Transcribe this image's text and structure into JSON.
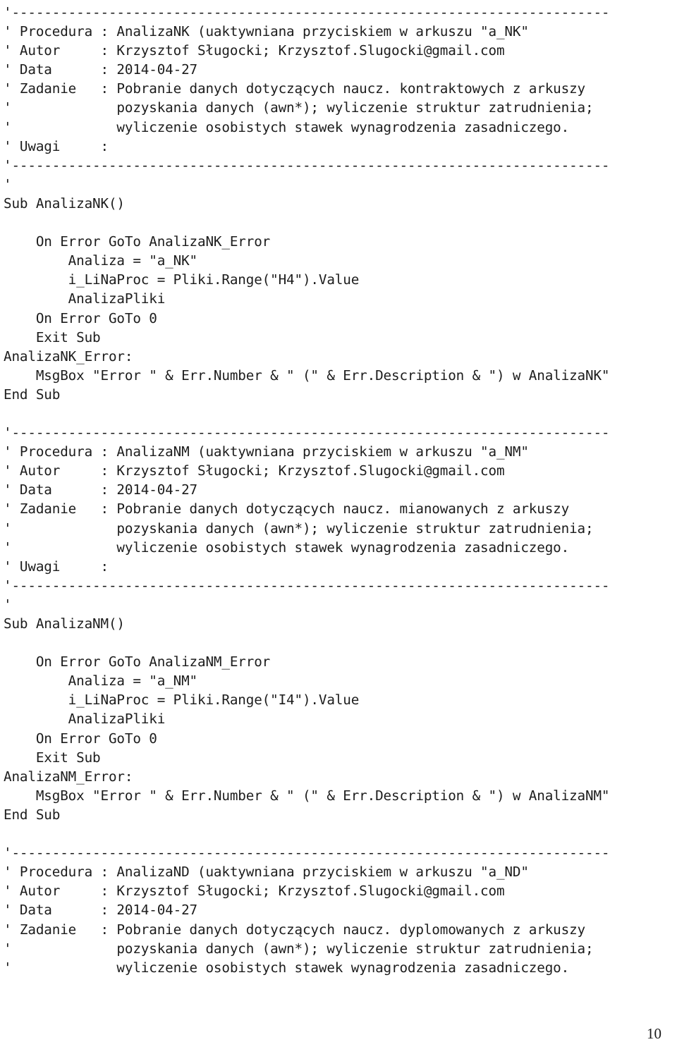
{
  "document": {
    "kind": "vba-source-code-listing",
    "language": "VBA",
    "page_number": "10",
    "text_color": "#1c1c1c",
    "background_color": "#ffffff"
  },
  "lines": [
    "'--------------------------------------------------------------------------",
    "' Procedura : AnalizaNK (uaktywniana przyciskiem w arkuszu \"a_NK\"",
    "' Autor     : Krzysztof Sługocki; Krzysztof.Slugocki@gmail.com",
    "' Data      : 2014-04-27",
    "' Zadanie   : Pobranie danych dotyczących naucz. kontraktowych z arkuszy",
    "'             pozyskania danych (awn*); wyliczenie struktur zatrudnienia;",
    "'             wyliczenie osobistych stawek wynagrodzenia zasadniczego.",
    "' Uwagi     :",
    "'--------------------------------------------------------------------------",
    "'",
    "Sub AnalizaNK()",
    "",
    "    On Error GoTo AnalizaNK_Error",
    "        Analiza = \"a_NK\"",
    "        i_LiNaProc = Pliki.Range(\"H4\").Value",
    "        AnalizaPliki",
    "    On Error GoTo 0",
    "    Exit Sub",
    "AnalizaNK_Error:",
    "    MsgBox \"Error \" & Err.Number & \" (\" & Err.Description & \") w AnalizaNK\"",
    "End Sub",
    "",
    "'--------------------------------------------------------------------------",
    "' Procedura : AnalizaNM (uaktywniana przyciskiem w arkuszu \"a_NM\"",
    "' Autor     : Krzysztof Sługocki; Krzysztof.Slugocki@gmail.com",
    "' Data      : 2014-04-27",
    "' Zadanie   : Pobranie danych dotyczących naucz. mianowanych z arkuszy",
    "'             pozyskania danych (awn*); wyliczenie struktur zatrudnienia;",
    "'             wyliczenie osobistych stawek wynagrodzenia zasadniczego.",
    "' Uwagi     :",
    "'--------------------------------------------------------------------------",
    "'",
    "Sub AnalizaNM()",
    "",
    "    On Error GoTo AnalizaNM_Error",
    "        Analiza = \"a_NM\"",
    "        i_LiNaProc = Pliki.Range(\"I4\").Value",
    "        AnalizaPliki",
    "    On Error GoTo 0",
    "    Exit Sub",
    "AnalizaNM_Error:",
    "    MsgBox \"Error \" & Err.Number & \" (\" & Err.Description & \") w AnalizaNM\"",
    "End Sub",
    "",
    "'--------------------------------------------------------------------------",
    "' Procedura : AnalizaND (uaktywniana przyciskiem w arkuszu \"a_ND\"",
    "' Autor     : Krzysztof Sługocki; Krzysztof.Slugocki@gmail.com",
    "' Data      : 2014-04-27",
    "' Zadanie   : Pobranie danych dotyczących naucz. dyplomowanych z arkuszy",
    "'             pozyskania danych (awn*); wyliczenie struktur zatrudnienia;",
    "'             wyliczenie osobistych stawek wynagrodzenia zasadniczego."
  ]
}
